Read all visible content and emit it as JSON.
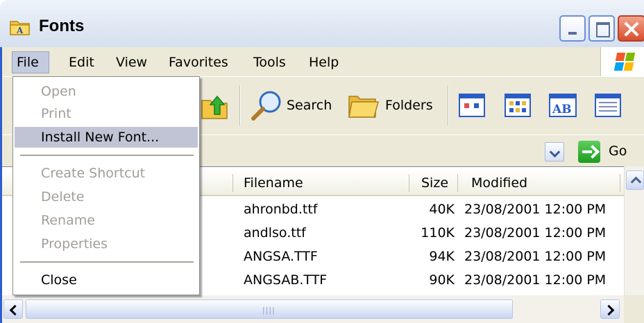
{
  "window": {
    "title": "Fonts"
  },
  "menubar": {
    "items": [
      "File",
      "Edit",
      "View",
      "Favorites",
      "Tools",
      "Help"
    ]
  },
  "toolbar": {
    "search_label": "Search",
    "folders_label": "Folders"
  },
  "addressbar": {
    "go_label": "Go"
  },
  "file_menu": {
    "items": [
      {
        "label": "Open",
        "enabled": false
      },
      {
        "label": "Print",
        "enabled": false
      },
      {
        "label": "Install New Font...",
        "enabled": true,
        "highlighted": true
      },
      {
        "label": "Create Shortcut",
        "enabled": false
      },
      {
        "label": "Delete",
        "enabled": false
      },
      {
        "label": "Rename",
        "enabled": false
      },
      {
        "label": "Properties",
        "enabled": false
      },
      {
        "label": "Close",
        "enabled": true
      }
    ]
  },
  "list": {
    "columns": {
      "filename": "Filename",
      "size": "Size",
      "modified": "Modified"
    },
    "rows": [
      {
        "filename": "ahronbd.ttf",
        "size": "40K",
        "modified": "23/08/2001 12:00 PM"
      },
      {
        "filename": "andlso.ttf",
        "size": "110K",
        "modified": "23/08/2001 12:00 PM"
      },
      {
        "filename": "ANGSA.TTF",
        "size": "94K",
        "modified": "23/08/2001 12:00 PM"
      },
      {
        "filename": "ANGSAB.TTF",
        "size": "90K",
        "modified": "23/08/2001 12:00 PM"
      }
    ]
  }
}
